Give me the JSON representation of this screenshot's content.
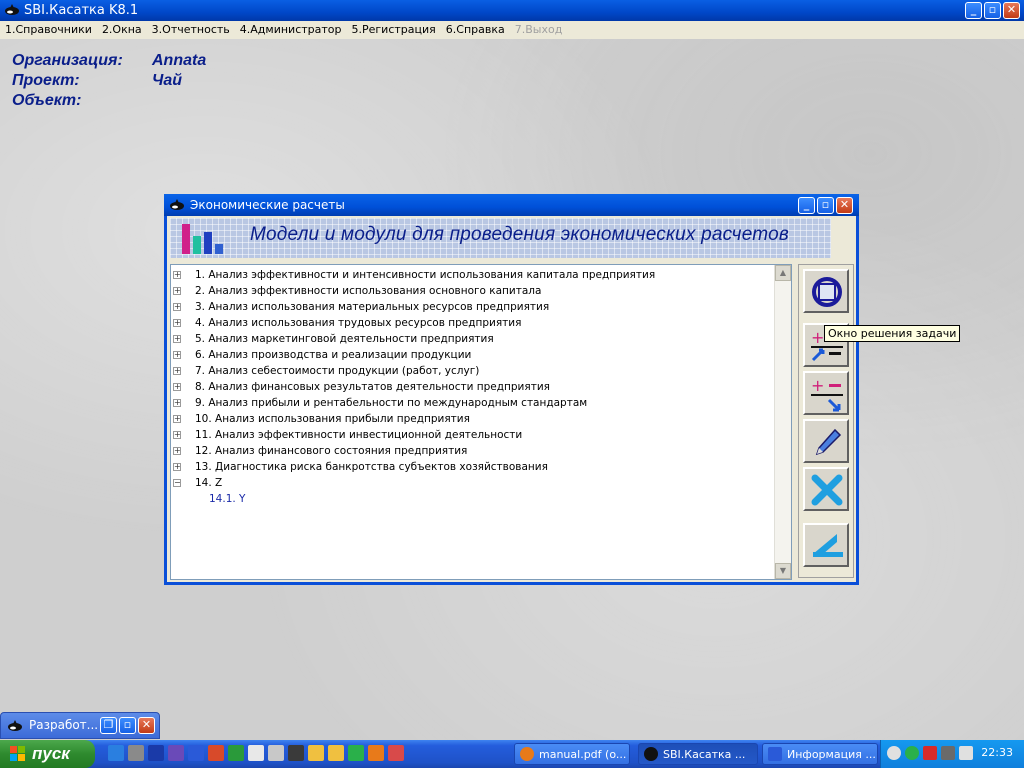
{
  "window": {
    "title": "SBI.Касатка K8.1",
    "controls": [
      "minimize-icon",
      "maximize-icon",
      "close-icon"
    ]
  },
  "menu": [
    {
      "label": "1.Справочники",
      "enabled": true
    },
    {
      "label": "2.Окна",
      "enabled": true
    },
    {
      "label": "3.Отчетность",
      "enabled": true
    },
    {
      "label": "4.Администратор",
      "enabled": true
    },
    {
      "label": "5.Регистрация",
      "enabled": true
    },
    {
      "label": "6.Справка",
      "enabled": true
    },
    {
      "label": "7.Выход",
      "enabled": false
    }
  ],
  "info": {
    "org_label": "Организация:",
    "org_value": "Annata",
    "project_label": "Проект:",
    "project_value": "Чай",
    "object_label": "Объект:",
    "object_value": ""
  },
  "dialog": {
    "title": "Экономические расчеты",
    "banner": "Модели и модули для проведения экономических расчетов",
    "tree": [
      {
        "label": "1. Анализ эффективности и интенсивности использования капитала предприятия",
        "expanded": false
      },
      {
        "label": "2. Анализ эффективности использования основного капитала",
        "expanded": false
      },
      {
        "label": "3. Анализ использования материальных ресурсов предприятия",
        "expanded": false
      },
      {
        "label": "4. Анализ использования трудовых ресурсов предприятия",
        "expanded": false
      },
      {
        "label": "5. Анализ маркетинговой деятельности предприятия",
        "expanded": false
      },
      {
        "label": "6. Анализ производства и реализации продукции",
        "expanded": false
      },
      {
        "label": "7. Анализ себестоимости продукции (работ, услуг)",
        "expanded": false
      },
      {
        "label": "8. Анализ финансовых результатов деятельности предприятия",
        "expanded": false
      },
      {
        "label": "9. Анализ прибыли и рентабельности  по международным стандартам",
        "expanded": false
      },
      {
        "label": "10. Анализ использования прибыли предприятия",
        "expanded": false
      },
      {
        "label": "11. Анализ эффективности инвестиционной деятельности",
        "expanded": false
      },
      {
        "label": "12. Анализ финансового состояния предприятия",
        "expanded": false
      },
      {
        "label": "13. Диагностика риска банкротства субъектов хозяйствования",
        "expanded": false
      },
      {
        "label": "14. Z",
        "expanded": true,
        "children": [
          "14.1. Y"
        ]
      }
    ],
    "tools": [
      "open-task-icon",
      "add-item-icon",
      "edit-formula-icon",
      "pencil-icon",
      "delete-icon",
      "back-icon"
    ],
    "tooltip": "Окно решения задачи"
  },
  "minimized": {
    "title": "Разработ..."
  },
  "taskbar": {
    "start_label": "пуск",
    "tasks": [
      {
        "label": "manual.pdf (o...",
        "icon": "firefox-icon",
        "active": false
      },
      {
        "label": "SBI.Касатка ...",
        "icon": "app-icon",
        "active": true
      },
      {
        "label": "Информация ...",
        "icon": "word-icon",
        "active": false
      }
    ],
    "clock": "22:33"
  },
  "colors": {
    "accent": "#0a1e8a",
    "titlebar": "#0050d8",
    "taskbar": "#245ddc",
    "start": "#2e8a2e"
  }
}
